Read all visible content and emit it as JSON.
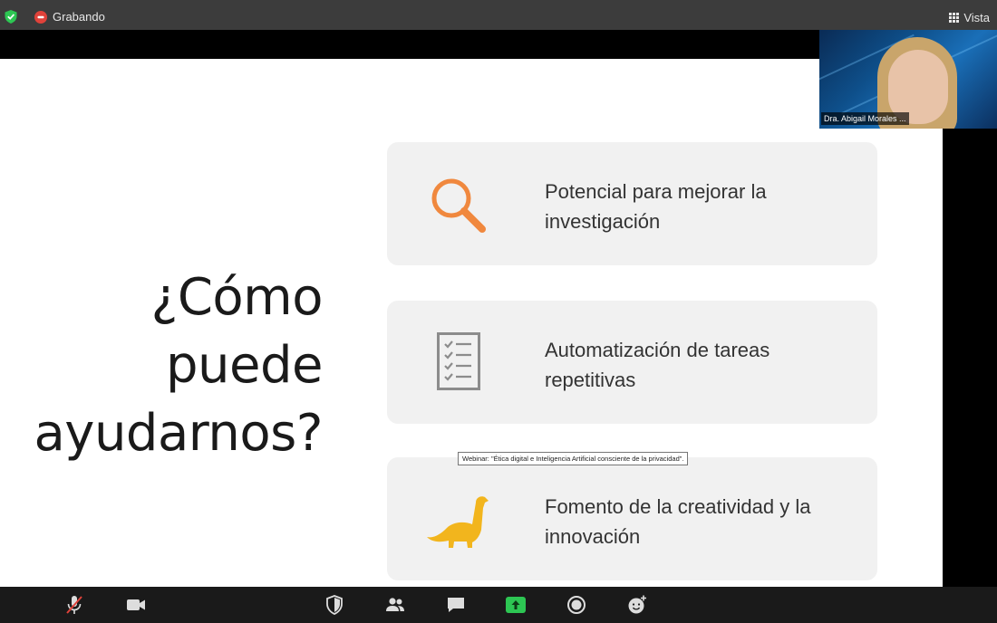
{
  "topbar": {
    "recording_label": "Grabando",
    "view_label": "Vista"
  },
  "slide": {
    "heading_lines": [
      "¿Cómo",
      "puede",
      "ayudarnos?"
    ],
    "cards": [
      {
        "line1": "Potencial para mejorar la",
        "line2": "investigación",
        "icon": "magnifier-icon"
      },
      {
        "line1": "Automatización de tareas",
        "line2": "repetitivas",
        "icon": "checklist-icon"
      },
      {
        "line1": "Fomento de la creatividad y la",
        "line2": "innovación",
        "icon": "dinosaur-icon"
      }
    ]
  },
  "tooltip": "Webinar: \"Ética digital e Inteligencia Artificial consciente de la privacidad\".",
  "participant": {
    "name": "Dra. Abigail Morales ..."
  },
  "toolbar": {
    "icons": [
      "muted-microphone-icon",
      "video-camera-icon",
      "security-shield-icon",
      "participants-icon",
      "chat-icon",
      "share-screen-icon",
      "record-icon",
      "reactions-icon"
    ]
  },
  "colors": {
    "topbar": "#3c3c3c",
    "toolbar": "#1a1a1a",
    "card_bg": "#f1f1f1",
    "magnifier": "#f0883e",
    "dinosaur": "#f2b51d",
    "share_green": "#2dc653",
    "shield_green": "#2dc653",
    "record_red": "#e0423a"
  }
}
